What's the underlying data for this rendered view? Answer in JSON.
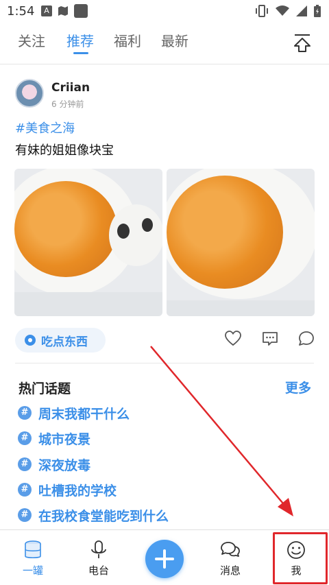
{
  "status_bar": {
    "time": "1:54",
    "icons": [
      "a-badge-icon",
      "map-icon",
      "square-icon",
      "vibrate-icon",
      "wifi-icon",
      "signal-icon",
      "battery-icon"
    ],
    "badge_letter": "A"
  },
  "tabs": [
    {
      "label": "关注",
      "active": false
    },
    {
      "label": "推荐",
      "active": true
    },
    {
      "label": "福利",
      "active": false
    },
    {
      "label": "最新",
      "active": false
    }
  ],
  "post": {
    "user": "Criian",
    "time": "6 分钟前",
    "hashtag": "#美食之海",
    "text": "有妹的姐姐像块宝",
    "tag": "吃点东西",
    "actions": [
      "heart-icon",
      "comment-icon",
      "share-icon"
    ]
  },
  "hot_topics": {
    "title": "热门话题",
    "more": "更多",
    "items": [
      {
        "label": "周末我都干什么"
      },
      {
        "label": "城市夜景"
      },
      {
        "label": "深夜放毒"
      },
      {
        "label": "吐槽我的学校"
      },
      {
        "label": "在我校食堂能吃到什么"
      }
    ],
    "icon_text": "#"
  },
  "bottom_nav": [
    {
      "label": "一罐",
      "icon": "jar-icon",
      "active": true
    },
    {
      "label": "电台",
      "icon": "microphone-icon",
      "active": false
    },
    {
      "label": "",
      "icon": "plus-icon",
      "active": false
    },
    {
      "label": "消息",
      "icon": "chat-bubbles-icon",
      "active": false
    },
    {
      "label": "我",
      "icon": "smiley-icon",
      "active": false
    }
  ],
  "colors": {
    "accent": "#3b8fe8",
    "annotation_red": "#e0272b"
  }
}
